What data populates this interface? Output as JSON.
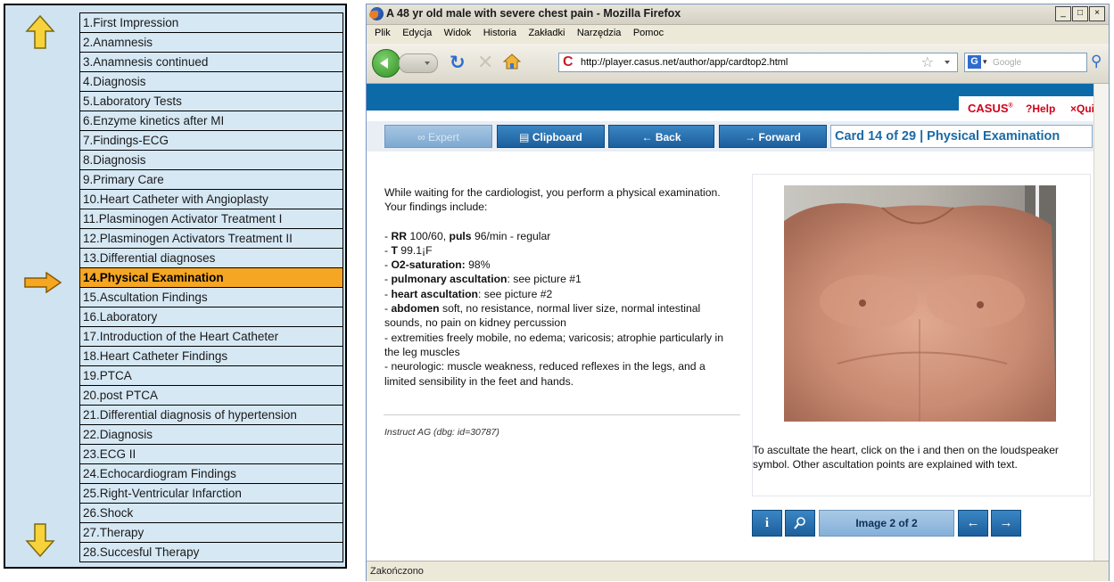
{
  "card_list": {
    "items": [
      "1.First Impression",
      "2.Anamnesis",
      "3.Anamnesis continued",
      "4.Diagnosis",
      "5.Laboratory Tests",
      "6.Enzyme kinetics after MI",
      "7.Findings-ECG",
      "8.Diagnosis",
      "9.Primary Care",
      "10.Heart Catheter with Angioplasty",
      "11.Plasminogen Activator Treatment I",
      "12.Plasminogen Activators Treatment II",
      "13.Differential diagnoses",
      "14.Physical Examination",
      "15.Ascultation Findings",
      "16.Laboratory",
      "17.Introduction of the Heart Catheter",
      "18.Heart Catheter Findings",
      "19.PTCA",
      "20.post PTCA",
      "21.Differential diagnosis of hypertension",
      "22.Diagnosis",
      "23.ECG II",
      "24.Echocardiogram Findings",
      "25.Right-Ventricular Infarction",
      "26.Shock",
      "27.Therapy",
      "28.Succesful Therapy"
    ],
    "active_index": 13,
    "colors": {
      "active": "#f5a623",
      "arrow": "#f7d23a"
    }
  },
  "window": {
    "title": "A 48 yr old male with severe chest pain - Mozilla Firefox",
    "controls": {
      "minimize": "_",
      "maximize": "□",
      "close": "×"
    }
  },
  "menu": [
    "Plik",
    "Edycja",
    "Widok",
    "Historia",
    "Zakładki",
    "Narzędzia",
    "Pomoc"
  ],
  "toolbar": {
    "url": "http://player.casus.net/author/app/cardtop2.html",
    "search_engine": "G",
    "search_placeholder": "Google"
  },
  "casus": {
    "logo": "CASUS",
    "help": "?Help",
    "quit": "×Quit",
    "brand_color": "#0c6aa8"
  },
  "nav": {
    "expert": "∞ Expert",
    "clipboard": "▤ Clipboard",
    "back": "← Back",
    "forward": "→ Forward",
    "card_title": "Card 14 of 29 | Physical Examination"
  },
  "exam": {
    "intro": "While waiting for the cardiologist, you perform a physical examination. Your findings include:",
    "rr_label": "RR",
    "rr_value": " 100/60, ",
    "pulse_label": "puls",
    "pulse_value": " 96/min - regular",
    "t_label": "T",
    "t_value": " 99.1¡F",
    "o2_label": "O2-saturation:",
    "o2_value": " 98%",
    "pulm_label": "pulmonary ascultation",
    "pulm_value": ": see picture #1",
    "heart_label": "heart ascultation",
    "heart_value": ": see picture #2",
    "abdomen_label": "abdomen",
    "abdomen_value": " soft, no resistance, normal liver size, normal intestinal sounds, no pain on kidney percussion",
    "extremities": "- extremities freely mobile, no edema; varicosis; atrophie particularly in the leg muscles",
    "neuro": "- neurologic: muscle weakness, reduced reflexes in the legs, and a limited sensibility in the feet and hands.",
    "instruct": "Instruct AG (dbg: id=30787)"
  },
  "image_panel": {
    "caption": "To ascultate the heart, click on the i and then on the loudspeaker symbol. Other ascultation points are explained with text.",
    "info": "i",
    "counter": "Image 2 of 2",
    "prev": "←",
    "next": "→"
  },
  "status": "Zakończono"
}
